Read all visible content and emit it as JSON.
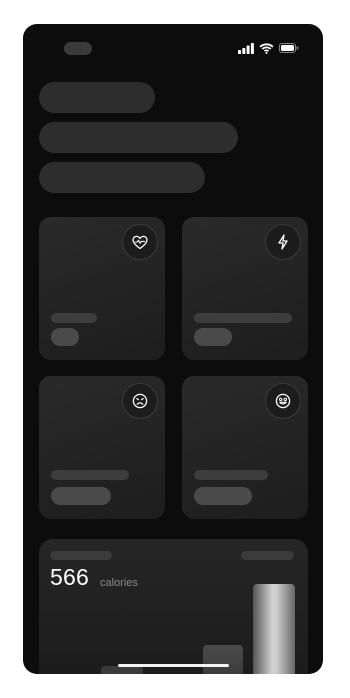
{
  "status_bar": {
    "signal_icon": "cellular-signal-icon",
    "wifi_icon": "wifi-icon",
    "battery_icon": "battery-icon"
  },
  "cards": [
    {
      "icon": "heart-pulse-icon"
    },
    {
      "icon": "lightning-icon"
    },
    {
      "icon": "sad-face-icon"
    },
    {
      "icon": "happy-face-icon"
    }
  ],
  "calories": {
    "value": "566",
    "unit": "calories"
  }
}
